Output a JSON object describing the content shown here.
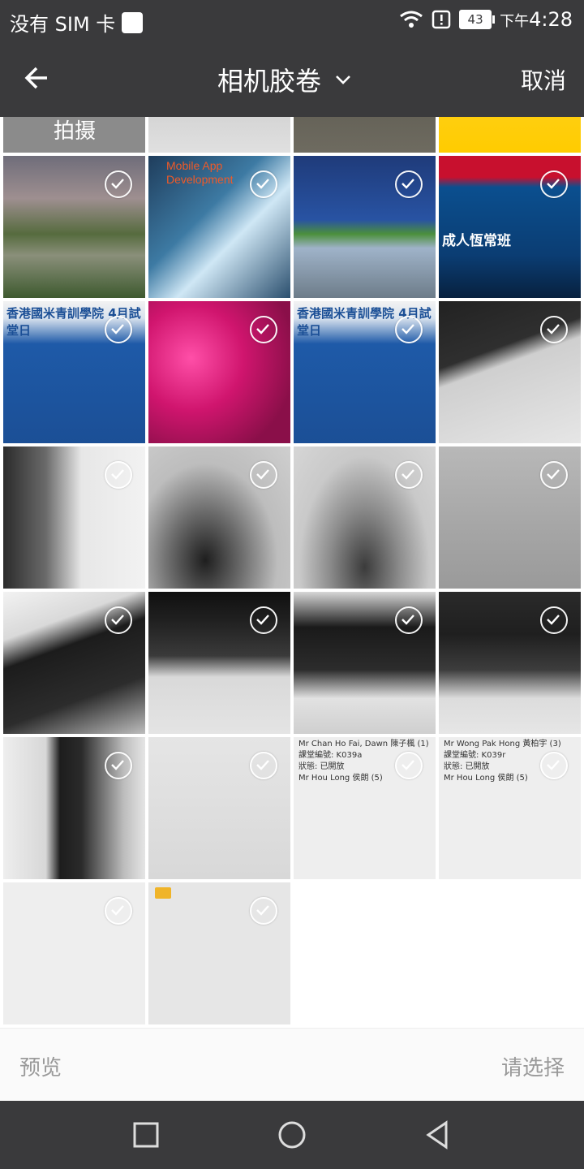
{
  "status_bar": {
    "carrier": "没有 SIM 卡",
    "battery": "43",
    "time_prefix": "下午",
    "time": "4:28"
  },
  "header": {
    "title": "相机胶卷",
    "cancel": "取消"
  },
  "grid": {
    "top_row": {
      "capture_label": "拍摄"
    },
    "tiles": [
      {
        "label": "Mobile App\nDevelopment"
      },
      {
        "label": "成人恆常班"
      },
      {
        "label": "香港國米青訓學院 4月試堂日"
      },
      {
        "label": "香港國米青訓學院 4月試堂日"
      },
      {
        "label": "Mr Chan Ho Fai, Dawn 陳子楓 (1)\n課堂編號: K039a\n狀態: 已開放\nMr Hou Long 侯朗 (5)"
      },
      {
        "label": "Mr Wong Pak Hong 黃柏宇 (3)\n課堂編號: K039r\n狀態: 已開放\nMr Hou Long 侯朗 (5)"
      }
    ]
  },
  "bottom_bar": {
    "preview": "预览",
    "choose": "请选择"
  }
}
